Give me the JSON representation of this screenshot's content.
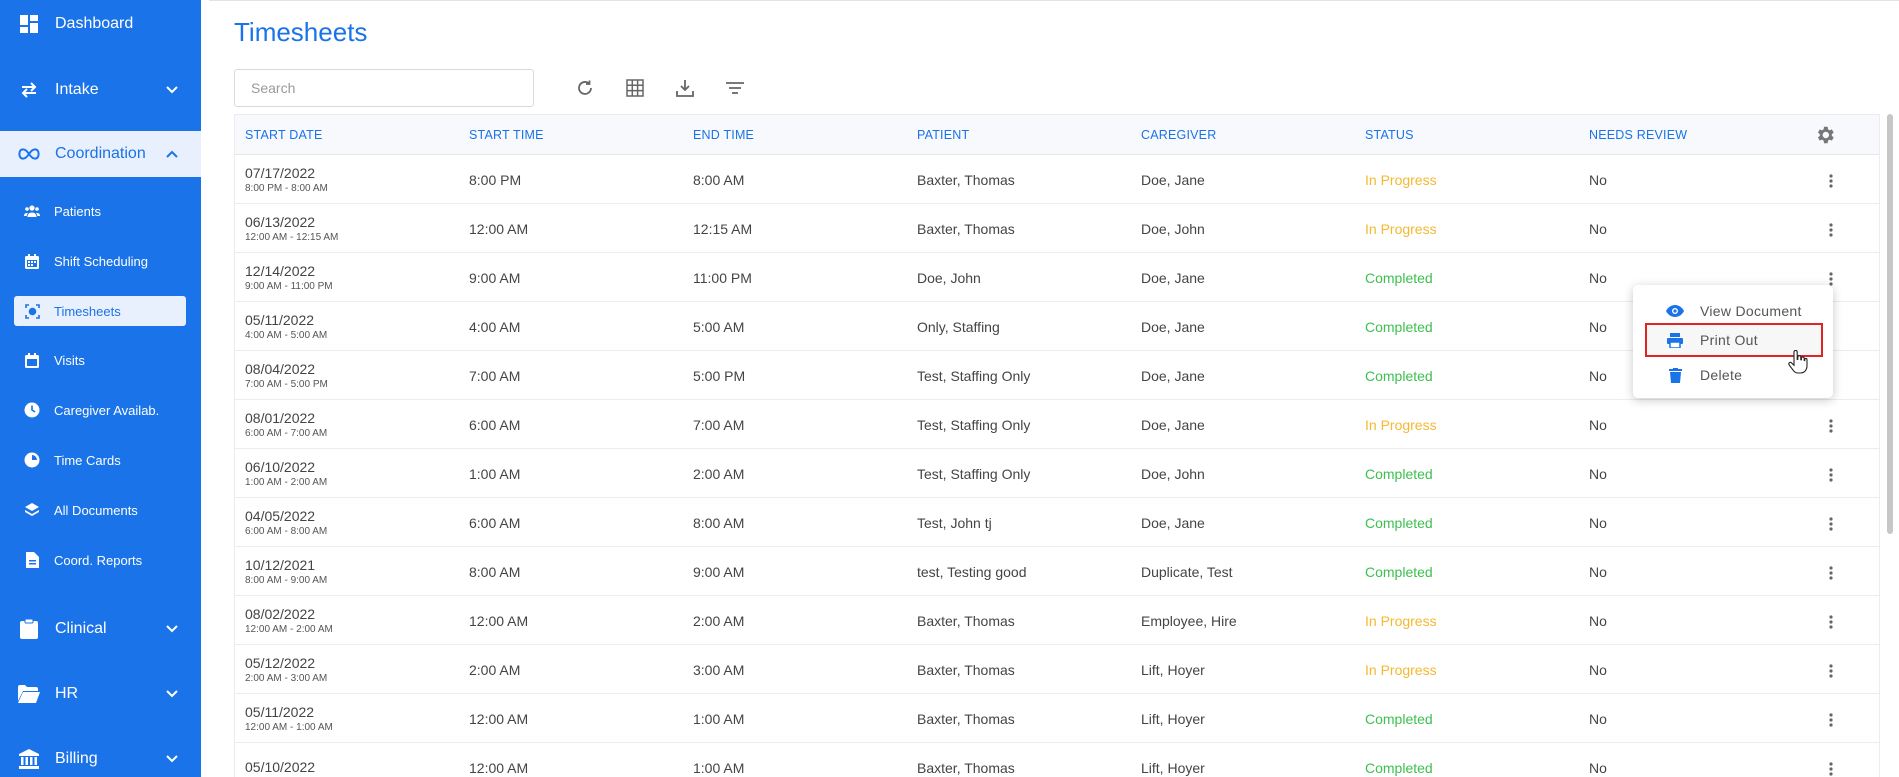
{
  "sidebar": {
    "dashboard": "Dashboard",
    "intake": "Intake",
    "coordination": "Coordination",
    "sub": {
      "patients": "Patients",
      "shift_scheduling": "Shift Scheduling",
      "timesheets": "Timesheets",
      "visits": "Visits",
      "caregiver_avail": "Caregiver Availab.",
      "time_cards": "Time Cards",
      "all_documents": "All Documents",
      "coord_reports": "Coord. Reports"
    },
    "clinical": "Clinical",
    "hr": "HR",
    "billing": "Billing"
  },
  "page": {
    "title": "Timesheets"
  },
  "search": {
    "placeholder": "Search",
    "value": ""
  },
  "toolbar": {
    "refresh_icon": "refresh-icon",
    "columns_icon": "grid-icon",
    "export_icon": "download-icon",
    "filter_icon": "filter-icon"
  },
  "columns": [
    "Start Date",
    "Start Time",
    "End Time",
    "Patient",
    "Caregiver",
    "Status",
    "Needs Review"
  ],
  "rows": [
    {
      "date": "07/17/2022",
      "range": "8:00 PM - 8:00 AM",
      "start": "8:00 PM",
      "end": "8:00 AM",
      "patient": "Baxter, Thomas",
      "caregiver": "Doe, Jane",
      "status": "In Progress",
      "review": "No"
    },
    {
      "date": "06/13/2022",
      "range": "12:00 AM - 12:15 AM",
      "start": "12:00 AM",
      "end": "12:15 AM",
      "patient": "Baxter, Thomas",
      "caregiver": "Doe, John",
      "status": "In Progress",
      "review": "No"
    },
    {
      "date": "12/14/2022",
      "range": "9:00 AM - 11:00 PM",
      "start": "9:00 AM",
      "end": "11:00 PM",
      "patient": "Doe, John",
      "caregiver": "Doe, Jane",
      "status": "Completed",
      "review": "No"
    },
    {
      "date": "05/11/2022",
      "range": "4:00 AM - 5:00 AM",
      "start": "4:00 AM",
      "end": "5:00 AM",
      "patient": "Only, Staffing",
      "caregiver": "Doe, Jane",
      "status": "Completed",
      "review": "No"
    },
    {
      "date": "08/04/2022",
      "range": "7:00 AM - 5:00 PM",
      "start": "7:00 AM",
      "end": "5:00 PM",
      "patient": "Test, Staffing Only",
      "caregiver": "Doe, Jane",
      "status": "Completed",
      "review": "No"
    },
    {
      "date": "08/01/2022",
      "range": "6:00 AM - 7:00 AM",
      "start": "6:00 AM",
      "end": "7:00 AM",
      "patient": "Test, Staffing Only",
      "caregiver": "Doe, Jane",
      "status": "In Progress",
      "review": "No"
    },
    {
      "date": "06/10/2022",
      "range": "1:00 AM - 2:00 AM",
      "start": "1:00 AM",
      "end": "2:00 AM",
      "patient": "Test, Staffing Only",
      "caregiver": "Doe, John",
      "status": "Completed",
      "review": "No"
    },
    {
      "date": "04/05/2022",
      "range": "6:00 AM - 8:00 AM",
      "start": "6:00 AM",
      "end": "8:00 AM",
      "patient": "Test, John tj",
      "caregiver": "Doe, Jane",
      "status": "Completed",
      "review": "No"
    },
    {
      "date": "10/12/2021",
      "range": "8:00 AM - 9:00 AM",
      "start": "8:00 AM",
      "end": "9:00 AM",
      "patient": "test, Testing good",
      "caregiver": "Duplicate, Test",
      "status": "Completed",
      "review": "No"
    },
    {
      "date": "08/02/2022",
      "range": "12:00 AM - 2:00 AM",
      "start": "12:00 AM",
      "end": "2:00 AM",
      "patient": "Baxter, Thomas",
      "caregiver": "Employee, Hire",
      "status": "In Progress",
      "review": "No"
    },
    {
      "date": "05/12/2022",
      "range": "2:00 AM - 3:00 AM",
      "start": "2:00 AM",
      "end": "3:00 AM",
      "patient": "Baxter, Thomas",
      "caregiver": "Lift, Hoyer",
      "status": "In Progress",
      "review": "No"
    },
    {
      "date": "05/11/2022",
      "range": "12:00 AM - 1:00 AM",
      "start": "12:00 AM",
      "end": "1:00 AM",
      "patient": "Baxter, Thomas",
      "caregiver": "Lift, Hoyer",
      "status": "Completed",
      "review": "No"
    },
    {
      "date": "05/10/2022",
      "range": "",
      "start": "12:00 AM",
      "end": "1:00 AM",
      "patient": "Baxter, Thomas",
      "caregiver": "Lift, Hoyer",
      "status": "Completed",
      "review": "No"
    }
  ],
  "context_menu": {
    "items": [
      {
        "label": "View Document",
        "icon": "eye-icon"
      },
      {
        "label": "Print Out",
        "icon": "printer-icon"
      },
      {
        "label": "Delete",
        "icon": "trash-icon"
      }
    ],
    "highlighted": "Print Out"
  },
  "colors": {
    "brand": "#1a73e8",
    "in_progress": "#f5b82e",
    "completed": "#3cc04e",
    "highlight_border": "#e02424"
  }
}
